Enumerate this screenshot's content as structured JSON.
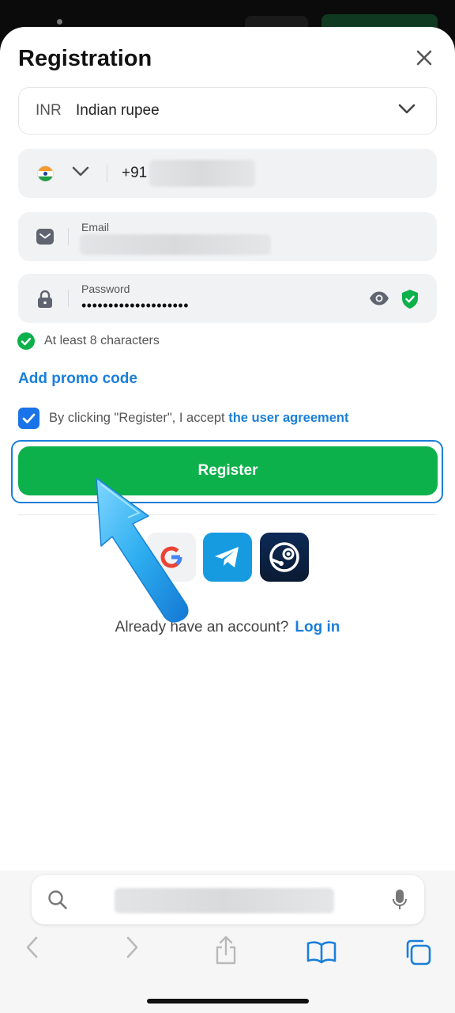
{
  "page": {
    "title": "Registration"
  },
  "currency": {
    "code": "INR",
    "name": "Indian rupee"
  },
  "phone": {
    "prefix": "+91"
  },
  "email": {
    "label": "Email"
  },
  "password": {
    "label": "Password",
    "masked_value": "••••••••••••••••••••"
  },
  "hint": {
    "text": "At least 8 characters"
  },
  "promo": {
    "label": "Add promo code"
  },
  "agreement": {
    "text": "By clicking \"Register\", I accept ",
    "link": "the user agreement"
  },
  "register": {
    "label": "Register"
  },
  "social": [
    "google-icon",
    "telegram-icon",
    "steam-icon"
  ],
  "account": {
    "question": "Already have an account?",
    "login": "Log in"
  },
  "colors": {
    "accent_green": "#0db14b",
    "link_blue": "#1a7fd9",
    "checkbox_blue": "#1a73e8"
  }
}
